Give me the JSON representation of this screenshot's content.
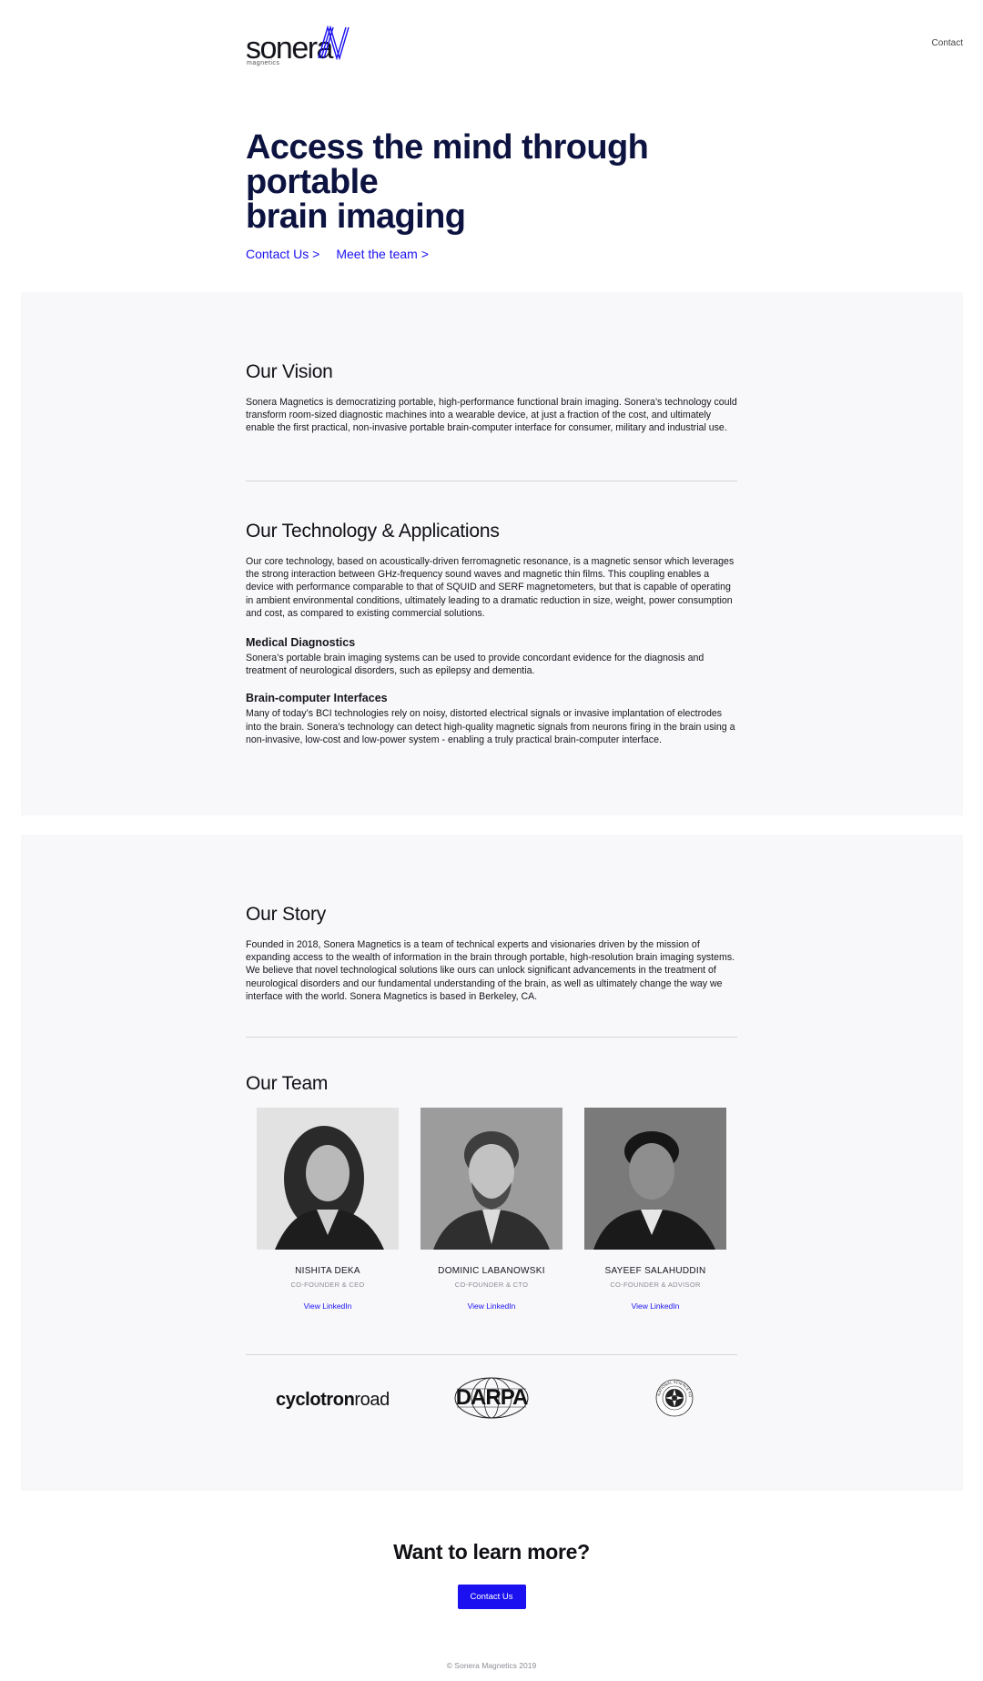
{
  "brand": {
    "name": "sonera",
    "sub": "magnetics",
    "accent": "#1b10f0",
    "navy": "#0d1340"
  },
  "nav": {
    "contact": "Contact"
  },
  "hero": {
    "title_line1": "Access the mind through portable",
    "title_line2": "brain imaging",
    "link_contact": "Contact Us >",
    "link_team": "Meet the team >"
  },
  "vision": {
    "title": "Our Vision",
    "body": "Sonera Magnetics is democratizing portable, high-performance functional brain imaging. Sonera’s technology could transform room-sized diagnostic machines into a wearable device, at just a fraction of the cost, and ultimately enable the first practical, non-invasive portable brain-computer interface for consumer, military and industrial use."
  },
  "technology": {
    "title": "Our Technology & Applications",
    "body": "Our core technology, based on acoustically-driven ferromagnetic resonance, is a magnetic sensor which leverages the strong interaction between GHz-frequency sound waves and magnetic thin films. This coupling enables a device with performance comparable to that of SQUID and SERF magnetometers, but that is capable of operating in ambient environmental conditions, ultimately leading to a dramatic reduction in size, weight, power consumption and cost, as compared to existing commercial solutions.",
    "app1_title": "Medical Diagnostics",
    "app1_body": "Sonera’s portable brain imaging systems can be used to provide concordant evidence for the diagnosis and treatment of neurological disorders, such as epilepsy and dementia.",
    "app2_title": "Brain-computer Interfaces",
    "app2_body": "Many of today’s BCI technologies rely on noisy, distorted electrical signals or invasive implantation of electrodes into the brain. Sonera’s technology can detect high-quality magnetic signals from neurons firing in the brain using a non-invasive, low-cost and low-power system - enabling a truly practical brain-computer interface."
  },
  "story": {
    "title": "Our Story",
    "body": "Founded in 2018, Sonera Magnetics is a team of technical experts and visionaries driven by the mission of expanding access to the wealth of information in the brain through portable, high-resolution brain imaging systems. We believe that novel technological solutions like ours can unlock significant advancements in the treatment of neurological disorders and our fundamental understanding of the brain, as well as ultimately change the way we interface with the world. Sonera Magnetics is based in Berkeley, CA."
  },
  "team": {
    "title": "Our Team",
    "members": [
      {
        "name": "NISHITA DEKA",
        "role": "CO-FOUNDER & CEO",
        "link": "View LinkedIn"
      },
      {
        "name": "DOMINIC LABANOWSKI",
        "role": "CO-FOUNDER & CTO",
        "link": "View LinkedIn"
      },
      {
        "name": "SAYEEF SALAHUDDIN",
        "role": "CO-FOUNDER & ADVISOR",
        "link": "View LinkedIn"
      }
    ]
  },
  "partners": {
    "cyclotron_bold": "cyclotron",
    "cyclotron_light": "road",
    "darpa": "DARPA",
    "nsf": "NATIONAL SCIENCE FOUNDATION"
  },
  "cta": {
    "title": "Want to learn more?",
    "button": "Contact Us"
  },
  "footer": {
    "copyright": "© Sonera Magnetics 2019"
  }
}
